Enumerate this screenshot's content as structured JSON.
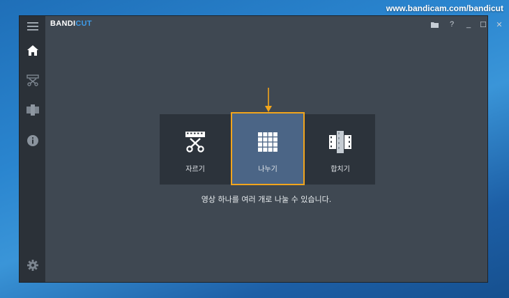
{
  "watermark": "www.bandicam.com/bandicut",
  "app": {
    "logo_part1": "BANDI",
    "logo_part2": "CUT",
    "accent": "#3d9be9"
  },
  "titlebar": {
    "help_label": "?",
    "minimize_label": "_",
    "maximize_label": "☐",
    "close_label": "✕"
  },
  "sidebar": {
    "items": [
      {
        "name": "menu",
        "icon": "hamburger-icon"
      },
      {
        "name": "home",
        "icon": "home-icon"
      },
      {
        "name": "cut",
        "icon": "cut-icon"
      },
      {
        "name": "join",
        "icon": "join-icon"
      },
      {
        "name": "info",
        "icon": "info-icon"
      },
      {
        "name": "settings",
        "icon": "gear-icon"
      }
    ]
  },
  "modes": [
    {
      "id": "trim",
      "label": "자르기",
      "icon": "film-scissors-icon",
      "selected": false
    },
    {
      "id": "split",
      "label": "나누기",
      "icon": "grid-icon",
      "selected": true
    },
    {
      "id": "join",
      "label": "합치기",
      "icon": "film-join-icon",
      "selected": false
    }
  ],
  "description": "영상 하나를 여러 개로 나눌 수 있습니다.",
  "highlight_color": "#f2a51c"
}
